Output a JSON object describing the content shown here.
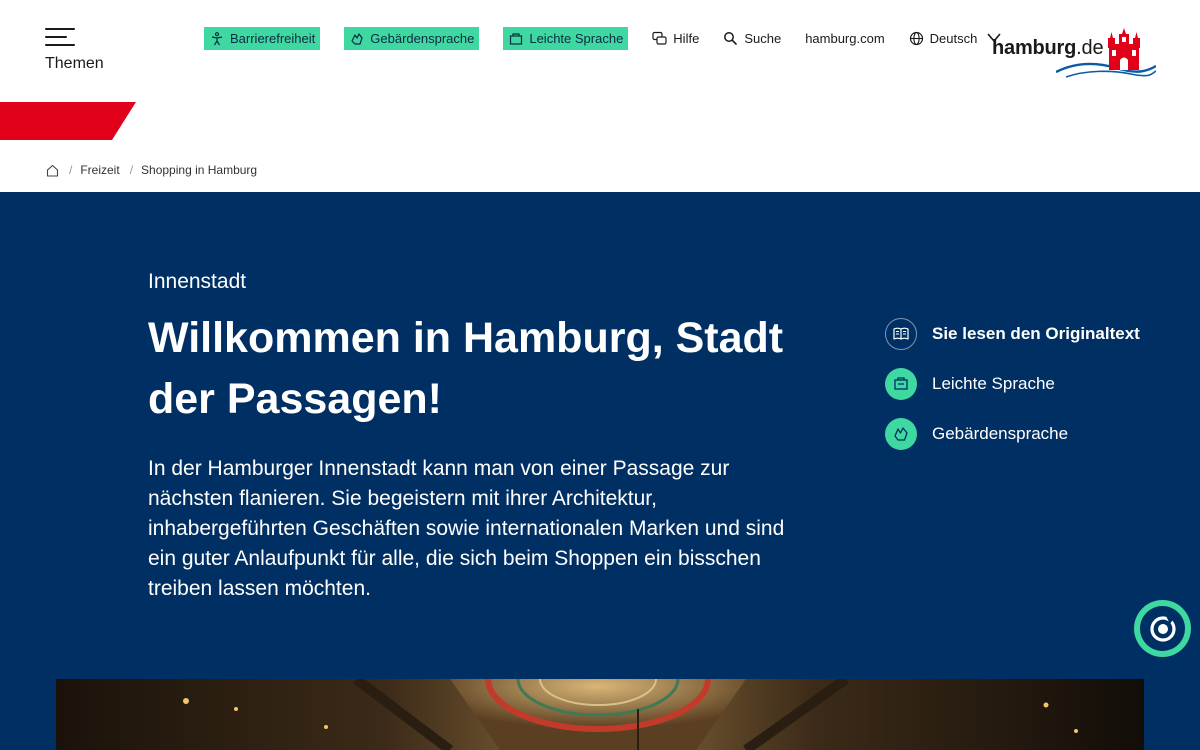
{
  "header": {
    "menu_label": "Themen",
    "nav": {
      "accessibility": "Barrierefreiheit",
      "sign_language": "Gebärdensprache",
      "easy_language": "Leichte Sprache",
      "help": "Hilfe",
      "search": "Suche",
      "portal": "hamburg.com",
      "language": "Deutsch"
    },
    "logo": {
      "word": "hamburg",
      "tld": ".de"
    }
  },
  "breadcrumb": {
    "items": [
      "Freizeit",
      "Shopping in Hamburg"
    ]
  },
  "hero": {
    "kicker": "Innenstadt",
    "title": "Willkommen in Hamburg, Stadt der Passagen!",
    "lead": "In der Hamburger Innenstadt kann man von einer Passage zur nächsten flanieren. Sie begeistern mit ihrer Architektur, inhabergeführten Geschäften sowie internationalen Marken und sind ein guter Anlaufpunkt für alle, die sich beim Shoppen ein bisschen treiben lassen möchten."
  },
  "language_options": [
    {
      "label": "Sie lesen den Originaltext",
      "icon": "book-icon",
      "active": true
    },
    {
      "label": "Leichte Sprache",
      "icon": "easy-language-icon",
      "active": false
    },
    {
      "label": "Gebärdensprache",
      "icon": "sign-language-icon",
      "active": false
    }
  ],
  "colors": {
    "brand_blue": "#003063",
    "accent_mint": "#3ed8a0",
    "brand_red": "#e10019"
  }
}
